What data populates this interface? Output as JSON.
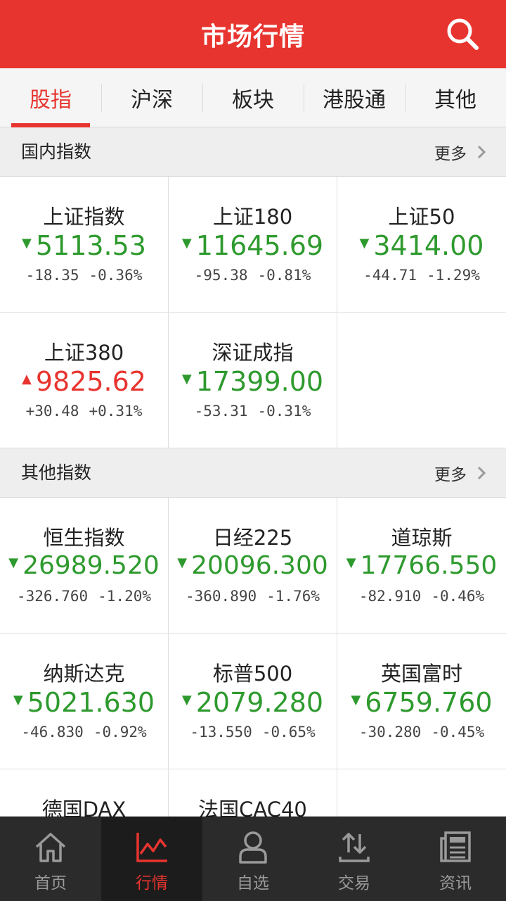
{
  "header": {
    "title": "市场行情",
    "search_icon": "search-icon"
  },
  "tabs": [
    {
      "label": "股指",
      "active": true
    },
    {
      "label": "沪深"
    },
    {
      "label": "板块"
    },
    {
      "label": "港股通"
    },
    {
      "label": "其他"
    }
  ],
  "domestic": {
    "title": "国内指数",
    "more": "更多",
    "items": [
      {
        "name": "上证指数",
        "price": "5113.53",
        "change": "-18.35",
        "pct": "-0.36%",
        "dir": "down"
      },
      {
        "name": "上证180",
        "price": "11645.69",
        "change": "-95.38",
        "pct": "-0.81%",
        "dir": "down"
      },
      {
        "name": "上证50",
        "price": "3414.00",
        "change": "-44.71",
        "pct": "-1.29%",
        "dir": "down"
      },
      {
        "name": "上证380",
        "price": "9825.62",
        "change": "+30.48",
        "pct": "+0.31%",
        "dir": "up"
      },
      {
        "name": "深证成指",
        "price": "17399.00",
        "change": "-53.31",
        "pct": "-0.31%",
        "dir": "down"
      }
    ]
  },
  "other": {
    "title": "其他指数",
    "more": "更多",
    "items": [
      {
        "name": "恒生指数",
        "price": "26989.520",
        "change": "-326.760",
        "pct": "-1.20%",
        "dir": "down"
      },
      {
        "name": "日经225",
        "price": "20096.300",
        "change": "-360.890",
        "pct": "-1.76%",
        "dir": "down"
      },
      {
        "name": "道琼斯",
        "price": "17766.550",
        "change": "-82.910",
        "pct": "-0.46%",
        "dir": "down"
      },
      {
        "name": "纳斯达克",
        "price": "5021.630",
        "change": "-46.830",
        "pct": "-0.92%",
        "dir": "down"
      },
      {
        "name": "标普500",
        "price": "2079.280",
        "change": "-13.550",
        "pct": "-0.65%",
        "dir": "down"
      },
      {
        "name": "英国富时",
        "price": "6759.760",
        "change": "-30.280",
        "pct": "-0.45%",
        "dir": "down"
      },
      {
        "name": "德国DAX",
        "price": "",
        "change": "",
        "pct": "",
        "dir": ""
      },
      {
        "name": "法国CAC40",
        "price": "",
        "change": "",
        "pct": "",
        "dir": ""
      }
    ]
  },
  "colors": {
    "accent": "#e8342f",
    "down": "#2e9a2e",
    "up": "#e8342f"
  },
  "arrows": {
    "down": "▼",
    "up": "▲"
  },
  "bottom_nav": [
    {
      "label": "首页",
      "icon": "home-icon"
    },
    {
      "label": "行情",
      "icon": "chart-icon",
      "active": true
    },
    {
      "label": "自选",
      "icon": "user-icon"
    },
    {
      "label": "交易",
      "icon": "trade-icon"
    },
    {
      "label": "资讯",
      "icon": "news-icon"
    }
  ]
}
